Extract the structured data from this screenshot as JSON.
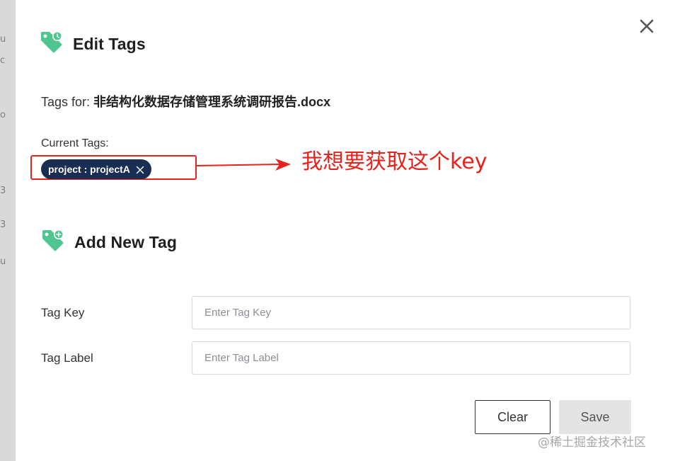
{
  "backdrop": {
    "fragments": [
      "u",
      "c",
      "o",
      "3",
      "3",
      "u"
    ]
  },
  "modal": {
    "title": "Edit Tags",
    "tags_for_label": "Tags for:",
    "file_name": "非结构化数据存储管理系统调研报告.docx",
    "current_tags_label": "Current Tags:",
    "current_tags": [
      {
        "text": "project : projectA"
      }
    ],
    "add_section_title": "Add New Tag",
    "fields": {
      "key_label": "Tag Key",
      "key_placeholder": "Enter Tag Key",
      "key_value": "",
      "label_label": "Tag Label",
      "label_placeholder": "Enter Tag Label",
      "label_value": ""
    },
    "buttons": {
      "clear": "Clear",
      "save": "Save"
    }
  },
  "annotation": {
    "text": "我想要获取这个key",
    "color": "#e8221b"
  },
  "watermark": "@稀土掘金技术社区",
  "colors": {
    "tag_icon_green": "#4fc58f",
    "chip_navy": "#1a2d52",
    "annotation_red": "#e8221b"
  },
  "icons": {
    "edit_tags_icon": "tag-clock-icon",
    "add_tag_icon": "tag-plus-icon",
    "close_icon": "close-icon",
    "chip_remove_icon": "chip-remove-icon"
  }
}
